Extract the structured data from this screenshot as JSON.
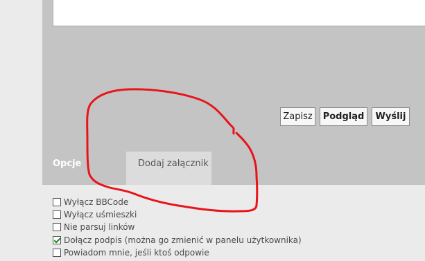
{
  "editor": {
    "buttons": {
      "save_label": "Zapisz",
      "preview_label": "Podgląd",
      "send_label": "Wyślij"
    }
  },
  "tabs": [
    {
      "label": "Opcje",
      "active": true
    },
    {
      "label": "Dodaj załącznik",
      "active": false
    }
  ],
  "options": [
    {
      "label": "Wyłącz BBCode",
      "checked": false
    },
    {
      "label": "Wyłącz uśmieszki",
      "checked": false
    },
    {
      "label": "Nie parsuj linków",
      "checked": false
    },
    {
      "label": "Dołącz podpis (można go zmienić w panelu użytkownika)",
      "checked": true
    },
    {
      "label": "Powiadom mnie, jeśli ktoś odpowie",
      "checked": false
    }
  ],
  "colors": {
    "panel_bg": "#c4c4c4",
    "page_bg": "#ebebeb",
    "annotation_stroke": "#e8141a",
    "check_mark": "#1a8a1a"
  }
}
